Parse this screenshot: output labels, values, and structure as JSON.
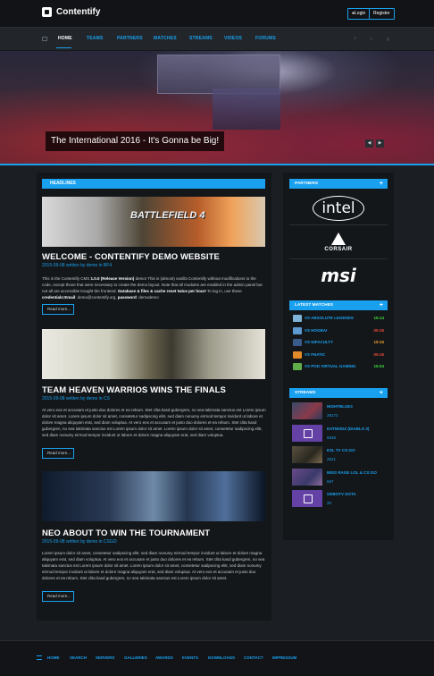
{
  "brand": {
    "name": "Contentify"
  },
  "auth": {
    "login": "Login",
    "register": "Register"
  },
  "nav": {
    "items": [
      {
        "label": "HOME"
      },
      {
        "label": "TEAMS"
      },
      {
        "label": "PARTNERS"
      },
      {
        "label": "MATCHES"
      },
      {
        "label": "STREAMS"
      },
      {
        "label": "VIDEOS"
      },
      {
        "label": "FORUMS"
      }
    ],
    "social": [
      "f",
      "t",
      "g"
    ]
  },
  "hero": {
    "caption": "The International 2016 - It's Gonna be Big!"
  },
  "headlines": {
    "title": "HEADLINES",
    "read_more": "Read more...",
    "articles": [
      {
        "image_text": "BATTLEFIELD 4",
        "title": "WELCOME - CONTENTIFY DEMO WEBSITE",
        "meta": "2015-09-08 written by demo in BF4",
        "body_1": "This is the Contentify CMS ",
        "body_bold_1": "1.0.0 (Release Version)",
        "body_2": " demo! This is (almost) vanilla Contentify without modifications to the code, except those that were necessary to create the demo layout. Note that all modules are enabled in the admin panel but not all are accessible trought the frontend. ",
        "body_bold_2": "Database & files & cache reset twice per hour!",
        "body_3": " To log in, use these ",
        "body_bold_3": "credentials:Email",
        "body_4": ": demo@contentify.org, ",
        "body_bold_4": "password",
        "body_5": ": demodemo"
      },
      {
        "title": "TEAM HEAVEN WARRIOS WINS THE FINALS",
        "meta": "2015-09-08 written by demo in CS",
        "body": "At vero eos et accusam et justo duo dolores et ea rebum. Stet clita kasd gubergren, no sea takimata sanctus est Lorem ipsum dolor sit amet. Lorem ipsum dolor sit amet, consetetur sadipscing elitr, sed diam nonumy eirmod tempor invidunt ut labore et dolore magna aliquyam erat, sed diam voluptua. At vero eos et accusam et justo duo dolores et ea rebum. Stet clita kasd gubergren, no sea takimata sanctus est Lorem ipsum dolor sit amet. Lorem ipsum dolor sit amet, consetetur sadipscing elitr, sed diam nonumy eirmod tempor invidunt ut labore et dolore magna aliquyam erat, sed diam voluptua."
      },
      {
        "title": "NEO ABOUT TO WIN THE TOURNAMENT",
        "meta": "2015-09-08 written by demo in CSGO",
        "body": "Lorem ipsum dolor sit amet, consetetur sadipscing elitr, sed diam nonumy eirmod tempor invidunt ut labore et dolore magna aliquyam erat, sed diam voluptua. At vero eos et accusam et justo duo dolores et ea rebum. Stet clita kasd gubergren, no sea takimata sanctus est Lorem ipsum dolor sit amet. Lorem ipsum dolor sit amet, consetetur sadipscing elitr, sed diam nonumy eirmod tempor invidunt ut labore et dolore magna aliquyam erat, sed diam voluptua. At vero eos et accusam et justo duo dolores et ea rebum. Stet clita kasd gubergren, no sea takimata sanctus est Lorem ipsum dolor sit amet."
      }
    ]
  },
  "partners": {
    "title": "PARTNERS",
    "logos": [
      {
        "name": "intel",
        "text": "intel"
      },
      {
        "name": "corsair",
        "text": "CORSAIR"
      },
      {
        "name": "msi",
        "text": "msi"
      }
    ]
  },
  "latest_matches": {
    "title": "LATEST MATCHES",
    "rows": [
      {
        "label": "VS ABSOLUTE LEGENDS",
        "score": "16:14",
        "score_color": "#3ddc3d",
        "icon_color": "#7fb3d8"
      },
      {
        "label": "VS HOGBAI",
        "score": "05:16",
        "score_color": "#e84a3a",
        "icon_color": "#5c9ad0"
      },
      {
        "label": "VS NIFACULTY",
        "score": "15:15",
        "score_color": "#f0a030",
        "icon_color": "#3a5a8a"
      },
      {
        "label": "VS FNATIC",
        "score": "05:16",
        "score_color": "#e84a3a",
        "icon_color": "#e08a2a"
      },
      {
        "label": "VS POD VIRTUAL GAMING",
        "score": "16:04",
        "score_color": "#3ddc3d",
        "icon_color": "#5fae4a"
      }
    ]
  },
  "streams": {
    "title": "STREAMS",
    "rows": [
      {
        "name": "NIGHTBLUE3",
        "viewers": "28172",
        "thumb": "game"
      },
      {
        "name": "DATMODZ (DIABLO 3)",
        "viewers": "5535",
        "thumb": "twitch"
      },
      {
        "name": "ESL TV CS:GO",
        "viewers": "2621",
        "thumb": "game"
      },
      {
        "name": "MISS RAGE LOL & CS:GO",
        "viewers": "667",
        "thumb": "game"
      },
      {
        "name": "GEBOTV DOTA",
        "viewers": "33",
        "thumb": "twitch"
      }
    ]
  },
  "footer": {
    "items": [
      {
        "label": "HOME"
      },
      {
        "label": "SEARCH"
      },
      {
        "label": "SERVERS"
      },
      {
        "label": "GALLERIES"
      },
      {
        "label": "AWARDS"
      },
      {
        "label": "EVENTS"
      },
      {
        "label": "DOWNLOADS"
      },
      {
        "label": "CONTACT"
      },
      {
        "label": "IMPRESSUM"
      }
    ]
  }
}
